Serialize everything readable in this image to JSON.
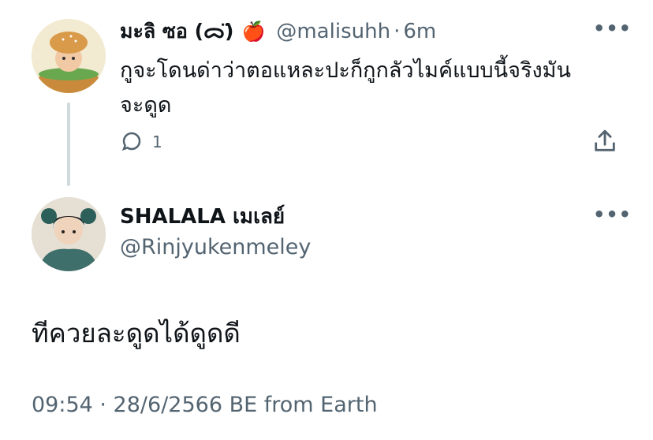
{
  "parent_tweet": {
    "display_name": "มะลิ ซอ (ᯅ̈)",
    "emoji": "🍎",
    "handle": "@malisuhh",
    "separator": "·",
    "time": "6m",
    "text_line1": "กูจะโดนด่าว่าตอแหละปะก็กูกลัวไมค์แบบนี้จริงมัน",
    "text_line2": "จะดูด",
    "reply_count": "1",
    "more_label": "•••",
    "avatar_icon": "burger-costume-avatar-icon"
  },
  "reply_tweet": {
    "display_name": "SHALALA เมเลย์",
    "handle": "@Rinjyukenmeley",
    "text": "ทีควยละดูดได้ดูดดี",
    "meta": "09:54 · 28/6/2566 BE from Earth",
    "more_label": "•••",
    "avatar_icon": "profile-photo-avatar-icon"
  },
  "colors": {
    "text_primary": "#0f1419",
    "text_secondary": "#536471",
    "thread_line": "#cfd9de"
  }
}
